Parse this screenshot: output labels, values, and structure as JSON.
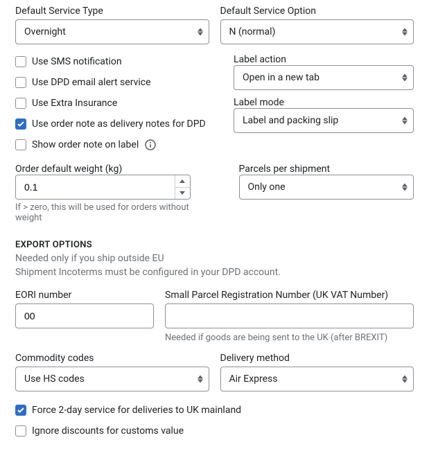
{
  "default_service_type": {
    "label": "Default Service Type",
    "value": "Overnight"
  },
  "default_service_option": {
    "label": "Default Service Option",
    "value": "N (normal)"
  },
  "checkboxes_left": {
    "sms": "Use SMS notification",
    "dpd_email": "Use DPD email alert service",
    "extra_ins": "Use Extra Insurance",
    "order_note": "Use order note as delivery notes for DPD",
    "show_note": "Show order note on label"
  },
  "label_action": {
    "label": "Label action",
    "value": "Open in a new tab"
  },
  "label_mode": {
    "label": "Label mode",
    "value": "Label and packing slip"
  },
  "weight": {
    "label": "Order default weight (kg)",
    "value": "0.1",
    "help": "If > zero, this will be used for orders without weight"
  },
  "parcels": {
    "label": "Parcels per shipment",
    "value": "Only one"
  },
  "export": {
    "heading": "EXPORT OPTIONS",
    "sub1": "Needed only if you ship outside EU",
    "sub2": "Shipment Incoterms must be configured in your DPD account."
  },
  "eori": {
    "label": "EORI number",
    "value": "00"
  },
  "sprn": {
    "label": "Small Parcel Registration Number (UK VAT Number)",
    "value": "",
    "help": "Needed if goods are being sent to the UK (after BREXIT)"
  },
  "commodity": {
    "label": "Commodity codes",
    "value": "Use HS codes"
  },
  "delivery": {
    "label": "Delivery method",
    "value": "Air Express"
  },
  "force_2day": "Force 2-day service for deliveries to UK mainland",
  "ignore_disc": "Ignore discounts for customs value"
}
